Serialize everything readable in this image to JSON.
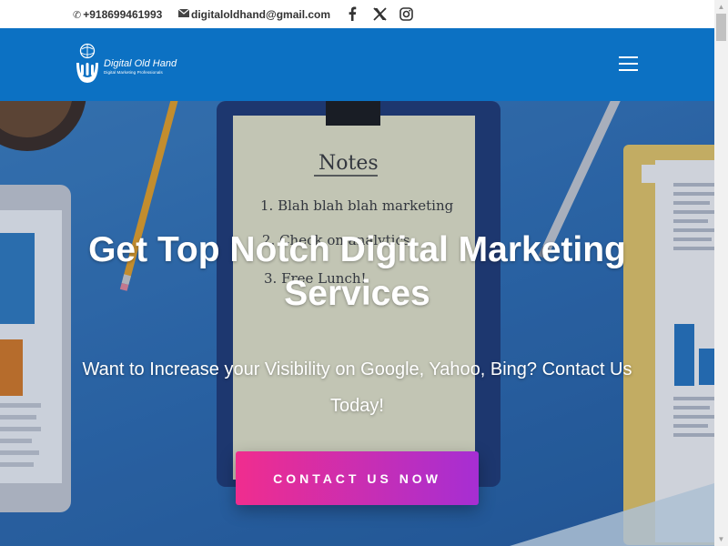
{
  "topbar": {
    "phone": "+918699461993",
    "email": "digitaloldhand@gmail.com",
    "social": [
      "facebook-icon",
      "x-icon",
      "instagram-icon"
    ]
  },
  "header": {
    "logo_name": "Digital Old Hand",
    "logo_tagline": "Digital Marketing Professionals",
    "menu_icon": "hamburger-menu-icon"
  },
  "hero": {
    "title": "Get Top Notch Digital Marketing Services",
    "subtitle": "Want to Increase your Visibility on Google, Yahoo, Bing? Contact Us Today!",
    "cta_label": "CONTACT US NOW",
    "notes_heading": "Notes",
    "notes_items": [
      "1. Blah blah blah marketing",
      "2. Check on analytics",
      "3. Free Lunch!"
    ]
  },
  "colors": {
    "header_bg": "#0c71c3",
    "cta_start": "#f02d8e",
    "cta_end": "#a62ed3"
  }
}
